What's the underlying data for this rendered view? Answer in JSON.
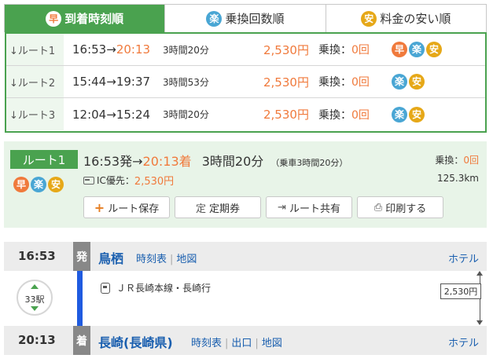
{
  "tabs": [
    {
      "badge": "早",
      "label": "到着時刻順",
      "active": true
    },
    {
      "badge": "楽",
      "label": "乗換回数順",
      "active": false
    },
    {
      "badge": "安",
      "label": "料金の安い順",
      "active": false
    }
  ],
  "routes": [
    {
      "label": "↓ルート1",
      "dep": "16:53",
      "arrow": "→",
      "arr": "20:13",
      "duration": "3時間20分",
      "fare": "2,530円",
      "transfer_label": "乗換：",
      "transfer_count": "0回",
      "badges": [
        "早",
        "楽",
        "安"
      ]
    },
    {
      "label": "↓ルート2",
      "dep": "15:44",
      "arrow": "→",
      "arr": "19:37",
      "duration": "3時間53分",
      "fare": "2,530円",
      "transfer_label": "乗換：",
      "transfer_count": "0回",
      "badges": [
        "楽",
        "安"
      ]
    },
    {
      "label": "↓ルート3",
      "dep": "12:04",
      "arrow": "→",
      "arr": "15:24",
      "duration": "3時間20分",
      "fare": "2,530円",
      "transfer_label": "乗換：",
      "transfer_count": "0回",
      "badges": [
        "楽",
        "安"
      ]
    }
  ],
  "detail": {
    "tag": "ルート1",
    "badges": [
      "早",
      "楽",
      "安"
    ],
    "dep": "16:53発",
    "arrow": "→",
    "arr": "20:13着",
    "duration": "3時間20分",
    "riding": "（乗車3時間20分）",
    "ic_label": "IC優先：",
    "ic_fare": "2,530円",
    "transfer_label": "乗換：",
    "transfer_count": "0回",
    "distance": "125.3km",
    "actions": [
      {
        "icon": "+",
        "label": "ルート保存"
      },
      {
        "icon": "定",
        "label": "定期券"
      },
      {
        "icon": "⇥",
        "label": "ルート共有"
      },
      {
        "icon": "⎙",
        "label": "印刷する"
      }
    ]
  },
  "departure": {
    "time": "16:53",
    "kind": "発",
    "station": "鳥栖",
    "links": [
      "時刻表",
      "地図"
    ],
    "hotel": "ホテル"
  },
  "segment": {
    "stops": "33駅",
    "train": "ＪＲ長崎本線・長崎行",
    "fare": "2,530円"
  },
  "arrival": {
    "time": "20:13",
    "kind": "着",
    "station": "長崎(長崎県)",
    "links": [
      "時刻表",
      "出口",
      "地図"
    ],
    "hotel": "ホテル"
  },
  "colors": {
    "brand_green": "#4aa24f",
    "accent_orange": "#f07a3c",
    "raku_blue": "#49a6d4",
    "yasu_yellow": "#e6a818",
    "line_blue": "#1f5be0",
    "link_blue": "#1a5faf"
  }
}
